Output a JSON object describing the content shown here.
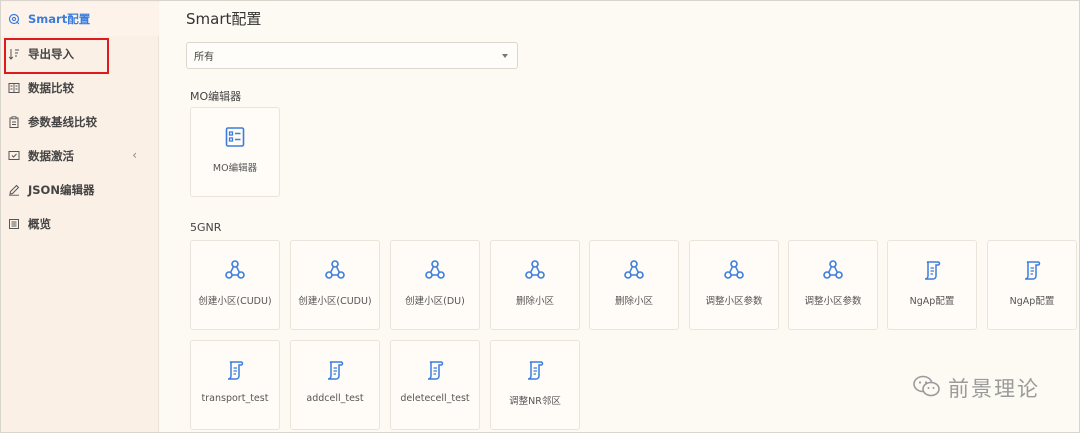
{
  "sidebar": {
    "items": [
      {
        "label": "Smart配置",
        "icon": "settings-icon",
        "active": true
      },
      {
        "label": "导出导入",
        "icon": "sort-icon",
        "active": false
      },
      {
        "label": "数据比较",
        "icon": "compare-icon",
        "active": false
      },
      {
        "label": "参数基线比较",
        "icon": "clipboard-icon",
        "active": false
      },
      {
        "label": "数据激活",
        "icon": "activate-icon",
        "active": false,
        "chevron": "‹"
      },
      {
        "label": "JSON编辑器",
        "icon": "edit-icon",
        "active": false
      },
      {
        "label": "概览",
        "icon": "list-icon",
        "active": false
      }
    ]
  },
  "main": {
    "title": "Smart配置",
    "filter": {
      "selected": "所有"
    },
    "sections": [
      {
        "label": "MO编辑器",
        "cards": [
          {
            "label": "MO编辑器",
            "icon": "form-icon"
          }
        ]
      },
      {
        "label": "5GNR",
        "cards": [
          {
            "label": "创建小区(CUDU)",
            "icon": "network-icon"
          },
          {
            "label": "创建小区(CUDU)",
            "icon": "network-icon"
          },
          {
            "label": "创建小区(DU)",
            "icon": "network-icon"
          },
          {
            "label": "删除小区",
            "icon": "network-icon"
          },
          {
            "label": "删除小区",
            "icon": "network-icon"
          },
          {
            "label": "调整小区参数",
            "icon": "network-icon"
          },
          {
            "label": "调整小区参数",
            "icon": "network-icon"
          },
          {
            "label": "NgAp配置",
            "icon": "scroll-icon"
          },
          {
            "label": "NgAp配置",
            "icon": "scroll-icon"
          },
          {
            "label": "transport_test",
            "icon": "scroll-icon"
          },
          {
            "label": "addcell_test",
            "icon": "scroll-icon"
          },
          {
            "label": "deletecell_test",
            "icon": "scroll-icon"
          },
          {
            "label": "调整NR邻区",
            "icon": "scroll-icon"
          }
        ]
      }
    ]
  },
  "watermark": {
    "text": "前景理论",
    "icon": "wechat-icon"
  },
  "colors": {
    "accent": "#3b7ddd",
    "highlight": "#e0191e",
    "sidebar_bg": "#fbf0e6",
    "page_bg": "#fdf9f3"
  }
}
